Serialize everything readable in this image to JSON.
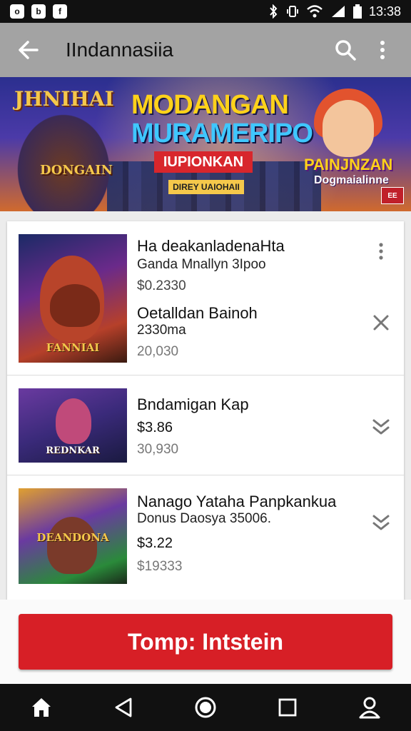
{
  "status_bar": {
    "left_icons": [
      "o",
      "b",
      "f"
    ],
    "time": "13:38",
    "icons": [
      "bluetooth-icon",
      "vibrate-icon",
      "wifi-icon",
      "signal-icon",
      "battery-icon"
    ]
  },
  "app_bar": {
    "title": "IIndannasiia",
    "icons": [
      "back-arrow-icon",
      "search-icon",
      "more-vert-icon"
    ]
  },
  "banner": {
    "left_title": "JHNIHAI",
    "left_subtitle": "DONGAIN",
    "main_line1": "MODANGAN",
    "main_line2": "MURAMERIPO",
    "ribbon": "IUPIONKAN",
    "small_tag": "DIREY UAIOHAII",
    "right_title": "PAINJNZAN",
    "right_subtitle": "Dogmaialinne",
    "badge": "EE"
  },
  "list": {
    "items": [
      {
        "title": "Ha deakanladenaHta",
        "subtitle": "Ganda Mnallyn 3Ipoo",
        "price": "$0.2330",
        "detail_title": "Oetalldan Bainoh",
        "detail_sub": "2330ma",
        "count": "20,030",
        "thumb_label": "FANNIAI",
        "actions": [
          "more-vert-icon",
          "close-icon"
        ]
      },
      {
        "title": "Bndamigan Kap",
        "price": "$3.86",
        "count": "30,930",
        "thumb_label": "REDNKAR",
        "action": "double-chevron-down-icon"
      },
      {
        "title": "Nanago Yataha Panpkankua",
        "subtitle": "Donus Daosya 35006.",
        "price": "$3.22",
        "count": "$19333",
        "thumb_label": "DEANDONA",
        "action": "double-chevron-down-icon"
      }
    ]
  },
  "cta": {
    "label": "Tomp: Intstein"
  },
  "nav_bar": {
    "icons": [
      "home-icon",
      "back-triangle-icon",
      "home-circle-icon",
      "recents-square-icon",
      "profile-icon"
    ]
  },
  "colors": {
    "accent": "#d71f26",
    "app_bar": "#a3a3a3",
    "status_bar": "#111111"
  }
}
